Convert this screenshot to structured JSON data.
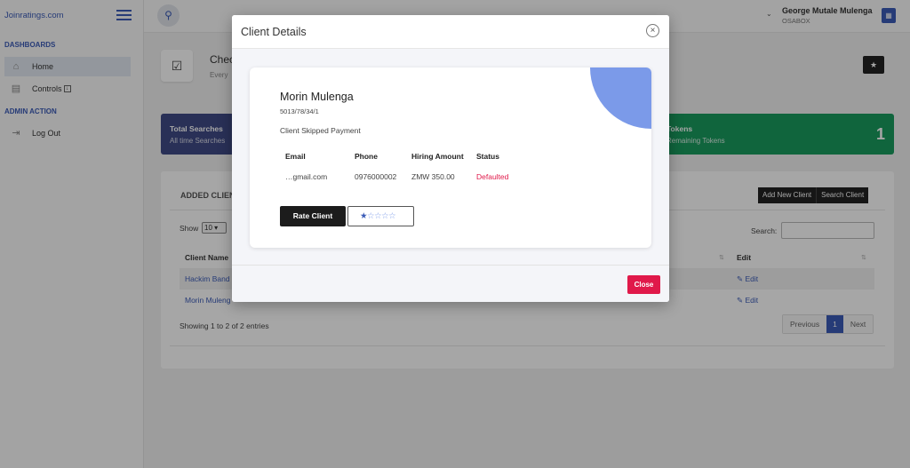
{
  "brand": "Joinratings.com",
  "sidebar": {
    "sections": [
      "DASHBOARDS",
      "ADMIN ACTION"
    ],
    "items": [
      {
        "label": "Home",
        "icon": "home-icon"
      },
      {
        "label": "Controls",
        "icon": "controls-icon"
      },
      {
        "label": "Log Out",
        "icon": "logout-icon"
      }
    ]
  },
  "header": {
    "user_name": "George Mutale Mulenga",
    "user_org": "OSABOX"
  },
  "page": {
    "title": "Chec",
    "subtitle": "Every"
  },
  "cards": {
    "searches_title": "Total Searches",
    "searches_sub": "All time Searches",
    "tokens_title": "Tokens",
    "tokens_sub": "Remaining Tokens",
    "tokens_value": "1"
  },
  "table_panel": {
    "title": "ADDED CLIEN",
    "buttons": [
      "Add New Client",
      "Search Client"
    ],
    "show_label": "Show",
    "show_value": "10",
    "search_label": "Search:",
    "columns": [
      "Client Name",
      "Edit"
    ],
    "rows": [
      {
        "name": "Hackim Band",
        "edit": "Edit"
      },
      {
        "name": "Morin Muleng",
        "edit": "Edit"
      }
    ],
    "info": "Showing 1 to 2 of 2 entries",
    "pager": {
      "prev": "Previous",
      "current": "1",
      "next": "Next"
    }
  },
  "modal": {
    "title": "Client Details",
    "client": {
      "name": "Morin Mulenga",
      "id": "5013/78/34/1",
      "status_text": "Client Skipped Payment",
      "headers": [
        "Email",
        "Phone",
        "Hiring Amount",
        "Status"
      ],
      "email": "…gmail.com",
      "phone": "0976000002",
      "amount": "ZMW 350.00",
      "status": "Defaulted",
      "rating": 1,
      "rating_max": 5
    },
    "rate_button": "Rate Client",
    "close_button": "Close"
  },
  "colors": {
    "accent": "#3b5bb7",
    "danger": "#e0194a",
    "success": "#1a9c5f",
    "card_dark": "#3f4a86",
    "decor_blue": "#7b9ae9"
  }
}
